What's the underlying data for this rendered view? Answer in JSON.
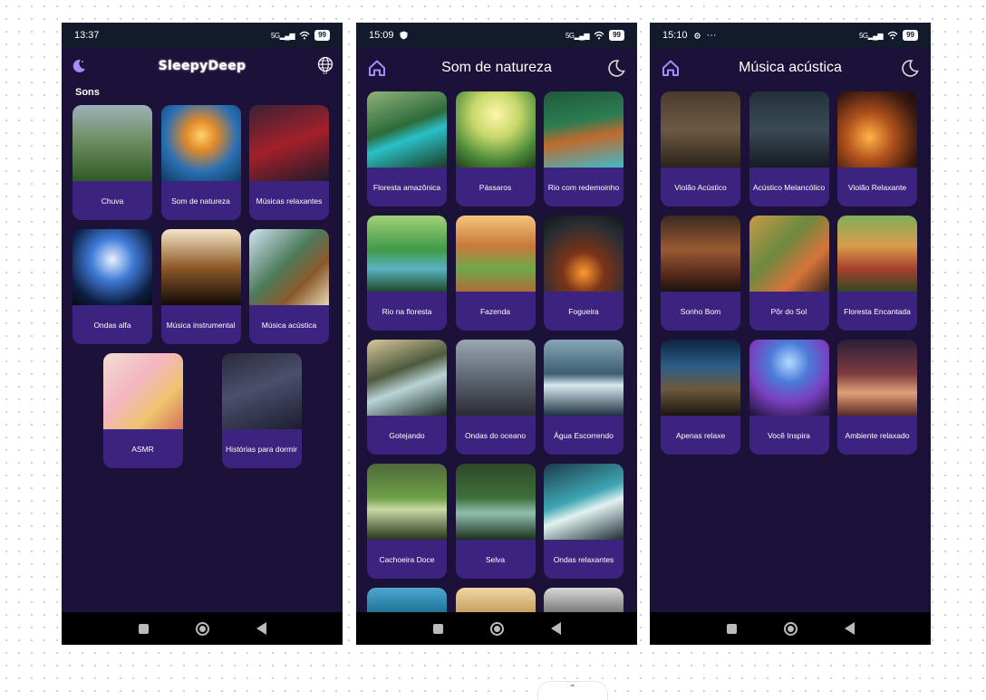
{
  "phone1": {
    "status": {
      "time": "13:37",
      "network": "5G",
      "battery": "99"
    },
    "header": {
      "brand": "SleepyDeep",
      "lang": "br"
    },
    "section_title": "Sons",
    "cards": [
      {
        "label": "Chuva"
      },
      {
        "label": "Som de natureza"
      },
      {
        "label": "Músicas relaxantes"
      },
      {
        "label": "Ondas alfa"
      },
      {
        "label": "Música instrumental"
      },
      {
        "label": "Música acústica"
      },
      {
        "label": "ASMR"
      },
      {
        "label": "Histórias para dormir"
      }
    ]
  },
  "phone2": {
    "status": {
      "time": "15:09",
      "network": "5G",
      "battery": "99"
    },
    "header": {
      "title": "Som de natureza"
    },
    "cards": [
      {
        "label": "Floresta amazônica"
      },
      {
        "label": "Pássaros"
      },
      {
        "label": "Rio com redemoinho"
      },
      {
        "label": "Rio na floresta"
      },
      {
        "label": "Fazenda"
      },
      {
        "label": "Fogueira"
      },
      {
        "label": "Gotejando"
      },
      {
        "label": "Ondas do oceano"
      },
      {
        "label": "Água Escorrendo"
      },
      {
        "label": "Cachoeira Doce"
      },
      {
        "label": "Selva"
      },
      {
        "label": "Ondas relaxantes"
      }
    ]
  },
  "phone3": {
    "status": {
      "time": "15:10",
      "network": "5G",
      "battery": "99",
      "extra": "···"
    },
    "header": {
      "title": "Música acústica"
    },
    "cards": [
      {
        "label": "Violão Acústico"
      },
      {
        "label": "Acústico Melancólico"
      },
      {
        "label": "Violão Relaxante"
      },
      {
        "label": "Sonho Bom"
      },
      {
        "label": "Pôr do Sol"
      },
      {
        "label": "Floresta Encantada"
      },
      {
        "label": "Apenas relaxe"
      },
      {
        "label": "Você Inspira"
      },
      {
        "label": "Ambiente relaxado"
      }
    ]
  },
  "colors": {
    "screen_bg": "#1c1138",
    "card_label_bg": "#3c2380",
    "status_bg": "#131a2c",
    "accent_icon": "#a78bfa"
  },
  "icons": [
    "moon-icon",
    "globe-icon",
    "home-icon",
    "wifi-icon",
    "signal-icon",
    "battery-icon",
    "shield-icon",
    "chevron-up-icon"
  ]
}
